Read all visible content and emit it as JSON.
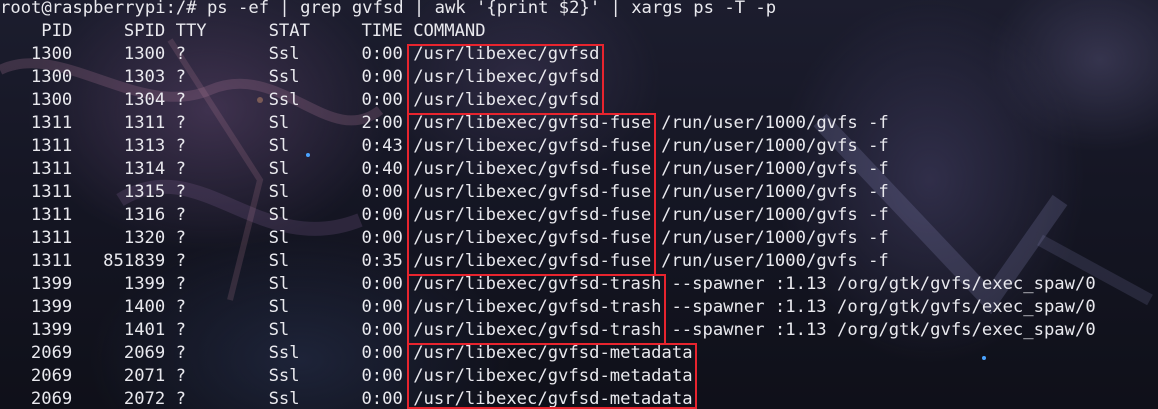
{
  "command_line": "root@raspberrypi:/# ps -ef | grep gvfsd | awk '{print $2}' | xargs ps -T -p",
  "header": {
    "pid": "PID",
    "spid": "SPID",
    "tty": "TTY",
    "stat": "STAT",
    "time": "TIME",
    "command": "COMMAND"
  },
  "rows": [
    {
      "pid": "1300",
      "spid": "1300",
      "tty": "?",
      "stat": "Ssl",
      "time": "0:00",
      "exe": "/usr/libexec/gvfsd",
      "args": ""
    },
    {
      "pid": "1300",
      "spid": "1303",
      "tty": "?",
      "stat": "Ssl",
      "time": "0:00",
      "exe": "/usr/libexec/gvfsd",
      "args": ""
    },
    {
      "pid": "1300",
      "spid": "1304",
      "tty": "?",
      "stat": "Ssl",
      "time": "0:00",
      "exe": "/usr/libexec/gvfsd",
      "args": ""
    },
    {
      "pid": "1311",
      "spid": "1311",
      "tty": "?",
      "stat": "Sl",
      "time": "2:00",
      "exe": "/usr/libexec/gvfsd-fuse",
      "args": "/run/user/1000/gvfs -f"
    },
    {
      "pid": "1311",
      "spid": "1313",
      "tty": "?",
      "stat": "Sl",
      "time": "0:43",
      "exe": "/usr/libexec/gvfsd-fuse",
      "args": "/run/user/1000/gvfs -f"
    },
    {
      "pid": "1311",
      "spid": "1314",
      "tty": "?",
      "stat": "Sl",
      "time": "0:40",
      "exe": "/usr/libexec/gvfsd-fuse",
      "args": "/run/user/1000/gvfs -f"
    },
    {
      "pid": "1311",
      "spid": "1315",
      "tty": "?",
      "stat": "Sl",
      "time": "0:00",
      "exe": "/usr/libexec/gvfsd-fuse",
      "args": "/run/user/1000/gvfs -f"
    },
    {
      "pid": "1311",
      "spid": "1316",
      "tty": "?",
      "stat": "Sl",
      "time": "0:00",
      "exe": "/usr/libexec/gvfsd-fuse",
      "args": "/run/user/1000/gvfs -f"
    },
    {
      "pid": "1311",
      "spid": "1320",
      "tty": "?",
      "stat": "Sl",
      "time": "0:00",
      "exe": "/usr/libexec/gvfsd-fuse",
      "args": "/run/user/1000/gvfs -f"
    },
    {
      "pid": "1311",
      "spid": "851839",
      "tty": "?",
      "stat": "Sl",
      "time": "0:35",
      "exe": "/usr/libexec/gvfsd-fuse",
      "args": "/run/user/1000/gvfs -f"
    },
    {
      "pid": "1399",
      "spid": "1399",
      "tty": "?",
      "stat": "Sl",
      "time": "0:00",
      "exe": "/usr/libexec/gvfsd-trash",
      "args": "--spawner :1.13 /org/gtk/gvfs/exec_spaw/0"
    },
    {
      "pid": "1399",
      "spid": "1400",
      "tty": "?",
      "stat": "Sl",
      "time": "0:00",
      "exe": "/usr/libexec/gvfsd-trash",
      "args": "--spawner :1.13 /org/gtk/gvfs/exec_spaw/0"
    },
    {
      "pid": "1399",
      "spid": "1401",
      "tty": "?",
      "stat": "Sl",
      "time": "0:00",
      "exe": "/usr/libexec/gvfsd-trash",
      "args": "--spawner :1.13 /org/gtk/gvfs/exec_spaw/0"
    },
    {
      "pid": "2069",
      "spid": "2069",
      "tty": "?",
      "stat": "Ssl",
      "time": "0:00",
      "exe": "/usr/libexec/gvfsd-metadata",
      "args": ""
    },
    {
      "pid": "2069",
      "spid": "2071",
      "tty": "?",
      "stat": "Ssl",
      "time": "0:00",
      "exe": "/usr/libexec/gvfsd-metadata",
      "args": ""
    },
    {
      "pid": "2069",
      "spid": "2072",
      "tty": "?",
      "stat": "Ssl",
      "time": "0:00",
      "exe": "/usr/libexec/gvfsd-metadata",
      "args": ""
    }
  ],
  "highlight_color": "#e8242e",
  "text_color": "#e9e9ee"
}
